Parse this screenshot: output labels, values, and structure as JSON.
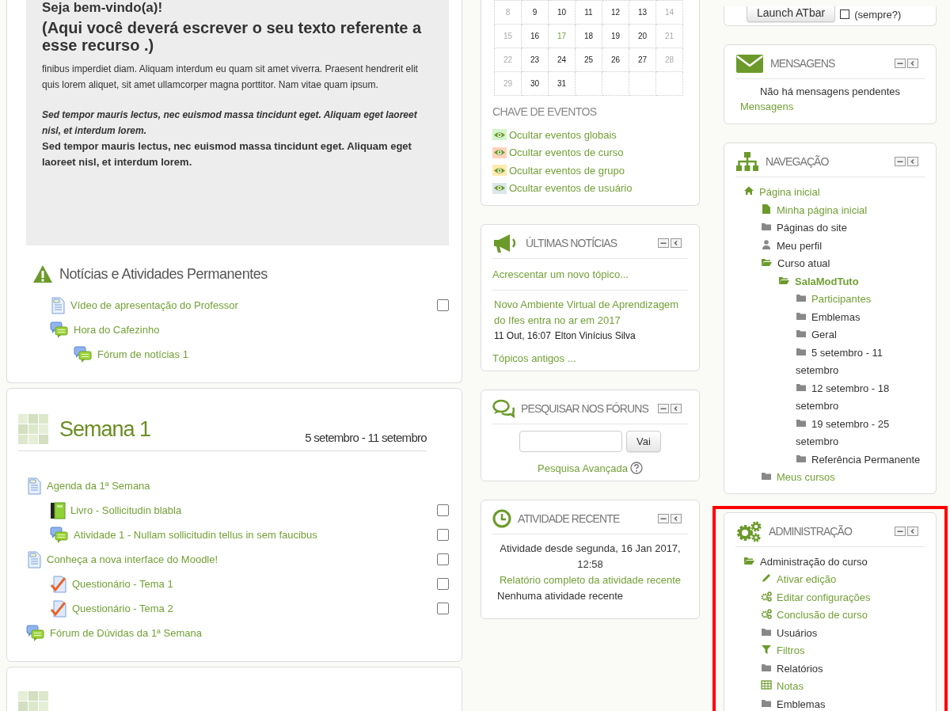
{
  "sections": [
    {
      "kind": "general",
      "summary": {
        "greeting": "Seja bem-vindo(a)!",
        "heading": "(Aqui você deverá escrever o seu texto referente a esse recurso .)",
        "paragraphs": [
          {
            "kind": "plain",
            "text": "finibus imperdiet diam. Aliquam interdum eu quam sit amet viverra.  Praesent hendrerit elit quis lorem aliquet, sit amet ullamcorper magna porttitor. Nam vitae quam ipsum."
          },
          {
            "kind": "italic-bold",
            "text": "Sed tempor mauris lectus, nec euismod massa tincidunt eget. Aliquam eget laoreet nisl, et interdum lorem."
          },
          {
            "kind": "bold",
            "text": "Sed tempor mauris lectus, nec euismod massa tincidunt eget. Aliquam eget laoreet nisl, et interdum lorem."
          }
        ]
      },
      "title": "Notícias e Atividades Permanentes",
      "activities": [
        {
          "kind": "page",
          "name": "Vídeo de apresentação do Professor",
          "checked": false
        },
        {
          "kind": "forum",
          "name": "Hora do Cafezinho",
          "children": [
            {
              "kind": "forum",
              "name": "Fórum de notícias 1"
            }
          ]
        }
      ]
    },
    {
      "kind": "week",
      "title": "Semana 1",
      "dates": "5 setembro - 11 setembro",
      "activities": [
        {
          "kind": "page",
          "name": "Agenda da 1ª Semana",
          "children": [
            {
              "kind": "book",
              "name": "Livro - Sollicitudin blabla",
              "checked": false
            },
            {
              "kind": "forum",
              "name": "Atividade 1 - Nullam sollicitudin tellus in sem faucibus",
              "checked": false
            }
          ]
        },
        {
          "kind": "page",
          "name": "Conheça a nova interface do Moodle!",
          "checked": false,
          "children": [
            {
              "kind": "quiz",
              "name": "Questionário - Tema 1",
              "checked": false
            },
            {
              "kind": "quiz",
              "name": "Questionário - Tema 2",
              "checked": false
            }
          ]
        },
        {
          "kind": "forum",
          "name": "Fórum de Dúvidas da 1ª Semana"
        }
      ]
    },
    {
      "kind": "week"
    }
  ],
  "middle_blocks": [
    {
      "kind": "calendar",
      "weeks": [
        [
          {
            "day": "8",
            "kind": "weekend"
          },
          {
            "day": "9",
            "kind": "weekday"
          },
          {
            "day": "10",
            "kind": "weekday"
          },
          {
            "day": "11",
            "kind": "weekday"
          },
          {
            "day": "12",
            "kind": "weekday"
          },
          {
            "day": "13",
            "kind": "weekday"
          },
          {
            "day": "14",
            "kind": "weekend"
          }
        ],
        [
          {
            "day": "15",
            "kind": "weekend"
          },
          {
            "day": "16",
            "kind": "weekday"
          },
          {
            "day": "17",
            "kind": "today"
          },
          {
            "day": "18",
            "kind": "weekday"
          },
          {
            "day": "19",
            "kind": "weekday"
          },
          {
            "day": "20",
            "kind": "weekday"
          },
          {
            "day": "21",
            "kind": "weekend"
          }
        ],
        [
          {
            "day": "22",
            "kind": "weekend"
          },
          {
            "day": "23",
            "kind": "weekday"
          },
          {
            "day": "24",
            "kind": "weekday"
          },
          {
            "day": "25",
            "kind": "weekday"
          },
          {
            "day": "26",
            "kind": "weekday"
          },
          {
            "day": "27",
            "kind": "weekday"
          },
          {
            "day": "28",
            "kind": "weekend"
          }
        ],
        [
          {
            "day": "29",
            "kind": "weekend"
          },
          {
            "day": "30",
            "kind": "weekday"
          },
          {
            "day": "31",
            "kind": "weekday"
          }
        ]
      ],
      "key_title": "CHAVE DE EVENTOS",
      "key": [
        {
          "label": "Ocultar eventos globais",
          "color": "#d3f5c9"
        },
        {
          "label": "Ocultar eventos de curso",
          "color": "#ffd3bd"
        },
        {
          "label": "Ocultar eventos de grupo",
          "color": "#ffeaae"
        },
        {
          "label": "Ocultar eventos de usuário",
          "color": "#dce7ec"
        }
      ]
    },
    {
      "kind": "news",
      "title": "ÚLTIMAS NOTÍCIAS",
      "add_link": "Acrescentar um novo tópico...",
      "posts": [
        {
          "title": "Novo Ambiente Virtual de Aprendizagem do Ifes entra no ar em 2017",
          "date": "11 Out, 16:07",
          "author": "Elton Vinícius Silva"
        }
      ],
      "older_link": "Tópicos antigos ..."
    },
    {
      "kind": "search",
      "title": "PESQUISAR NOS FÓRUNS",
      "button": "Vai",
      "advanced_link": "Pesquisa Avançada"
    },
    {
      "kind": "recent",
      "title": "ATIVIDADE RECENTE",
      "since": "Atividade desde segunda, 16 Jan 2017, 12:58",
      "report_link": "Relatório completo da atividade recente",
      "empty": "Nenhuma atividade recente"
    }
  ],
  "right_blocks": [
    {
      "kind": "atbar",
      "highlighted": false,
      "button": "Launch ATbar",
      "checkbox_label": "(sempre?)",
      "checked": false
    },
    {
      "kind": "messages",
      "highlighted": false,
      "title": "MENSAGENS",
      "note": "Não há mensagens pendentes",
      "link": "Mensagens"
    },
    {
      "kind": "navigation",
      "highlighted": false,
      "title": "NAVEGAÇÃO",
      "items": [
        {
          "kind": "home-link",
          "label": "Página inicial",
          "children": [
            {
              "kind": "page-link",
              "label": "Minha página inicial"
            },
            {
              "kind": "folder",
              "label": "Páginas do site"
            },
            {
              "kind": "user",
              "label": "Meu perfil"
            },
            {
              "kind": "folder-open",
              "label": "Curso atual",
              "children": [
                {
                  "kind": "course-current",
                  "label": "SalaModTuto",
                  "children": [
                    {
                      "kind": "folder-link",
                      "label": "Participantes"
                    },
                    {
                      "kind": "folder",
                      "label": "Emblemas"
                    },
                    {
                      "kind": "folder",
                      "label": "Geral"
                    },
                    {
                      "kind": "folder",
                      "label": "5 setembro - 11 setembro"
                    },
                    {
                      "kind": "folder",
                      "label": "12 setembro - 18 setembro"
                    },
                    {
                      "kind": "folder",
                      "label": "19 setembro - 25 setembro"
                    },
                    {
                      "kind": "folder",
                      "label": "Referência Permanente"
                    }
                  ]
                }
              ]
            },
            {
              "kind": "folder-link",
              "label": "Meus cursos"
            }
          ]
        }
      ]
    },
    {
      "kind": "administration",
      "highlighted": true,
      "title": "ADMINISTRAÇÃO",
      "items": [
        {
          "kind": "folder-open",
          "label": "Administração do curso",
          "children": [
            {
              "kind": "pencil-link",
              "label": "Ativar edição"
            },
            {
              "kind": "gears-link",
              "label": "Editar configurações"
            },
            {
              "kind": "gears-link",
              "label": "Conclusão de curso"
            },
            {
              "kind": "folder",
              "label": "Usuários"
            },
            {
              "kind": "filter-link",
              "label": "Filtros"
            },
            {
              "kind": "folder",
              "label": "Relatórios"
            },
            {
              "kind": "grid-link",
              "label": "Notas"
            },
            {
              "kind": "folder",
              "label": "Emblemas"
            }
          ]
        }
      ]
    }
  ]
}
